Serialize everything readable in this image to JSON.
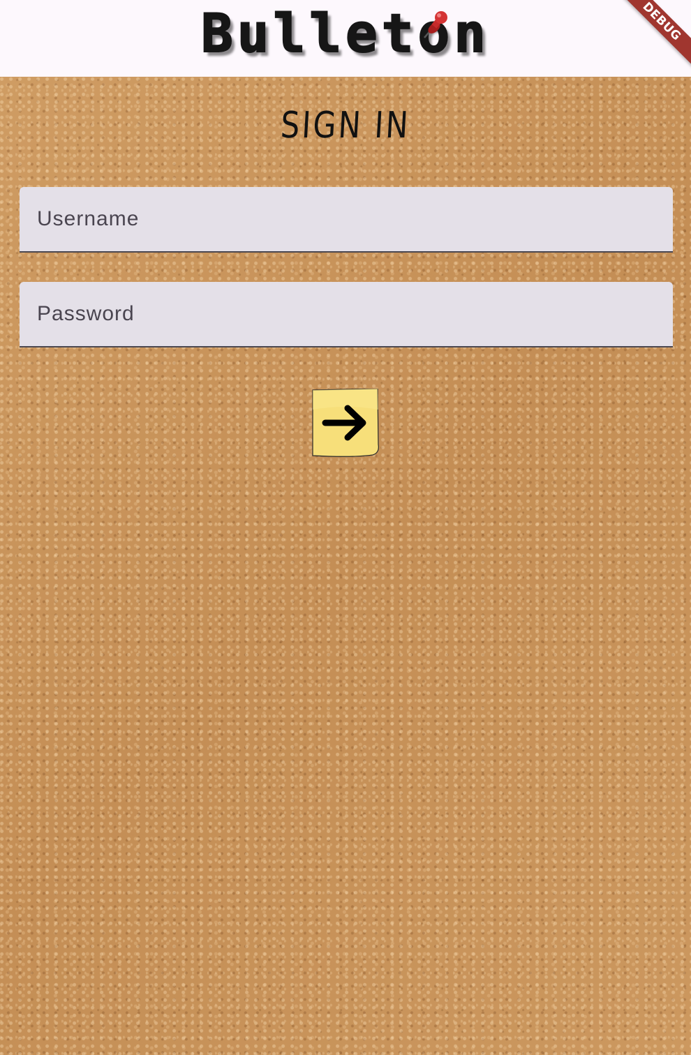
{
  "app_bar": {
    "logo_text": "Bulleton",
    "debug_banner": "DEBUG",
    "pin_icon": "red-pushpin-icon"
  },
  "form": {
    "title": "SIGN IN",
    "username": {
      "placeholder": "Username",
      "value": ""
    },
    "password": {
      "placeholder": "Password",
      "value": ""
    },
    "submit_icon": "arrow-right-icon"
  },
  "colors": {
    "app_bar_bg": "#fdf8fd",
    "cork_bg": "#c9955c",
    "field_bg": "#e4e0e8",
    "sticky_note": "#f7df7a",
    "debug_banner": "#a0362f",
    "pin": "#c62a2a"
  }
}
